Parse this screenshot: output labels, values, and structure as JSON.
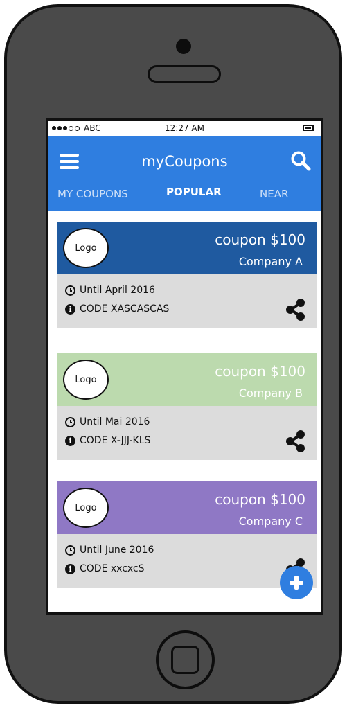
{
  "status_bar": {
    "carrier": "ABC",
    "time": "12:27 AM"
  },
  "app": {
    "title": "myCoupons"
  },
  "tabs": [
    {
      "label": "MY COUPONS",
      "active": false
    },
    {
      "label": "POPULAR",
      "active": true
    },
    {
      "label": "NEAR",
      "active": false
    }
  ],
  "coupons": [
    {
      "logo": "Logo",
      "amount": "coupon $100",
      "company": "Company A",
      "until": "Until April 2016",
      "code": "CODE XASCASCAS",
      "color": "#1f5aa0"
    },
    {
      "logo": "Logo",
      "amount": "coupon $100",
      "company": "Company B",
      "until": "Until Mai 2016",
      "code": "CODE X-JJJ-KLS",
      "color": "#bcdaae"
    },
    {
      "logo": "Logo",
      "amount": "coupon $100",
      "company": "Company C",
      "until": "Until June 2016",
      "code": "CODE xxcxcS",
      "color": "#8f78c5"
    }
  ],
  "colors": {
    "header": "#2f7ee0",
    "card_body": "#dcdcdc",
    "fab": "#2f7ee0"
  },
  "icons": [
    "menu-icon",
    "search-icon",
    "clock-icon",
    "info-icon",
    "share-icon",
    "plus-icon"
  ]
}
